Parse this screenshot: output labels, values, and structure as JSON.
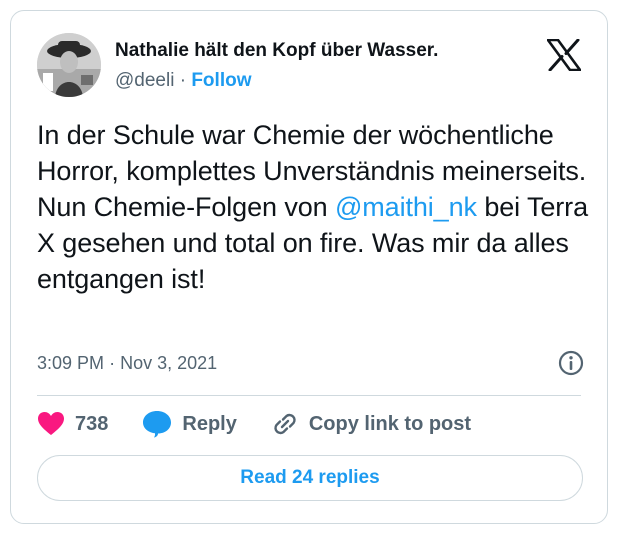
{
  "author": {
    "display_name": "Nathalie hält den Kopf über Wasser.",
    "handle": "@deeli",
    "separator": "·",
    "follow_label": "Follow"
  },
  "tweet": {
    "text_before": "In der Schule war Chemie der wöchentliche Horror, komplettes Unverständnis meinerseits. Nun Chemie-Folgen von ",
    "mention": "@maithi_nk",
    "text_after": " bei Terra X gesehen und total on fire. Was mir da alles entgangen ist!"
  },
  "meta": {
    "time": "3:09 PM",
    "separator": "·",
    "date": "Nov 3, 2021"
  },
  "actions": {
    "like_count": "738",
    "reply_label": "Reply",
    "copy_link_label": "Copy link to post"
  },
  "replies": {
    "read_label": "Read 24 replies"
  },
  "icons": {
    "logo": "x-logo-icon",
    "info": "info-icon",
    "like": "heart-icon",
    "reply": "speech-bubble-icon",
    "copy_link": "link-icon"
  },
  "colors": {
    "accent": "#1d9bf0",
    "like": "#f91880",
    "text": "#0f1419",
    "secondary": "#536471",
    "border": "#cfd9de"
  }
}
